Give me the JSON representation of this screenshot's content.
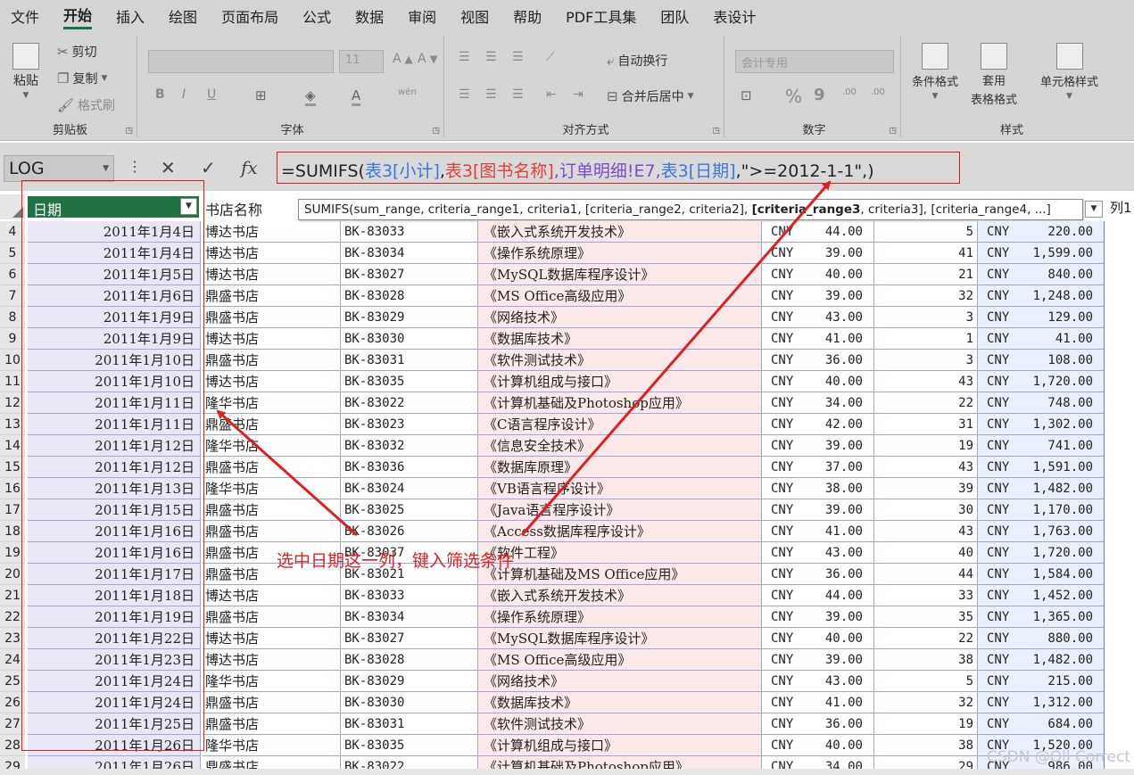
{
  "menu": [
    "文件",
    "开始",
    "插入",
    "绘图",
    "页面布局",
    "公式",
    "数据",
    "审阅",
    "视图",
    "帮助",
    "PDF工具集",
    "团队",
    "表设计"
  ],
  "ribbon": {
    "clipboard": {
      "paste": "粘贴",
      "cut": "剪切",
      "copy": "复制",
      "format_painter": "格式刷",
      "group": "剪贴板"
    },
    "font": {
      "font_size": "11",
      "bold": "B",
      "italic": "I",
      "underline": "U",
      "phonetic": "wén",
      "group": "字体"
    },
    "alignment": {
      "wrap": "自动换行",
      "merge": "合并后居中",
      "group": "对齐方式"
    },
    "number": {
      "format": "会计专用",
      "percent": "%",
      "comma": "9",
      "inc_decimal": ".00",
      "dec_decimal": ".00",
      "group": "数字"
    },
    "styles": {
      "conditional": "条件格式",
      "table_style_1": "套用",
      "table_style_2": "表格格式",
      "cell_style": "单元格样式",
      "group": "样式"
    }
  },
  "formula_bar": {
    "name_box": "LOG",
    "cancel": "✕",
    "enter": "✓",
    "fx": "fx",
    "formula": {
      "p1": "=SUMIFS(",
      "p2": "表3[小计]",
      "p3": ",",
      "p4": "表3[图书名称]",
      "p5": ",订单明细!E7,",
      "p6": "表3[日期]",
      "p7": ",\">=2012-1-1\",)"
    }
  },
  "tooltip": {
    "before": "SUMIFS(sum_range, criteria_range1, criteria1, [criteria_range2, criteria2], ",
    "bold": "[criteria_range3",
    "after": ", criteria3], [criteria_range4, ...]"
  },
  "headers": {
    "date": "日期",
    "store": "书店名称",
    "col1": "列1"
  },
  "rows": [
    {
      "n": "4",
      "date": "2011年1月4日",
      "store": "博达书店",
      "code": "BK-83033",
      "book": "《嵌入式系统开发技术》",
      "cur": "CNY",
      "price": "44.00",
      "qty": "5",
      "sub_cur": "CNY",
      "sub": "220.00"
    },
    {
      "n": "5",
      "date": "2011年1月4日",
      "store": "博达书店",
      "code": "BK-83034",
      "book": "《操作系统原理》",
      "cur": "CNY",
      "price": "39.00",
      "qty": "41",
      "sub_cur": "CNY",
      "sub": "1,599.00"
    },
    {
      "n": "6",
      "date": "2011年1月5日",
      "store": "博达书店",
      "code": "BK-83027",
      "book": "《MySQL数据库程序设计》",
      "cur": "CNY",
      "price": "40.00",
      "qty": "21",
      "sub_cur": "CNY",
      "sub": "840.00"
    },
    {
      "n": "7",
      "date": "2011年1月6日",
      "store": "鼎盛书店",
      "code": "BK-83028",
      "book": "《MS Office高级应用》",
      "cur": "CNY",
      "price": "39.00",
      "qty": "32",
      "sub_cur": "CNY",
      "sub": "1,248.00"
    },
    {
      "n": "8",
      "date": "2011年1月9日",
      "store": "鼎盛书店",
      "code": "BK-83029",
      "book": "《网络技术》",
      "cur": "CNY",
      "price": "43.00",
      "qty": "3",
      "sub_cur": "CNY",
      "sub": "129.00"
    },
    {
      "n": "9",
      "date": "2011年1月9日",
      "store": "博达书店",
      "code": "BK-83030",
      "book": "《数据库技术》",
      "cur": "CNY",
      "price": "41.00",
      "qty": "1",
      "sub_cur": "CNY",
      "sub": "41.00"
    },
    {
      "n": "10",
      "date": "2011年1月10日",
      "store": "鼎盛书店",
      "code": "BK-83031",
      "book": "《软件测试技术》",
      "cur": "CNY",
      "price": "36.00",
      "qty": "3",
      "sub_cur": "CNY",
      "sub": "108.00"
    },
    {
      "n": "11",
      "date": "2011年1月10日",
      "store": "博达书店",
      "code": "BK-83035",
      "book": "《计算机组成与接口》",
      "cur": "CNY",
      "price": "40.00",
      "qty": "43",
      "sub_cur": "CNY",
      "sub": "1,720.00"
    },
    {
      "n": "12",
      "date": "2011年1月11日",
      "store": "隆华书店",
      "code": "BK-83022",
      "book": "《计算机基础及Photoshop应用》",
      "cur": "CNY",
      "price": "34.00",
      "qty": "22",
      "sub_cur": "CNY",
      "sub": "748.00"
    },
    {
      "n": "13",
      "date": "2011年1月11日",
      "store": "鼎盛书店",
      "code": "BK-83023",
      "book": "《C语言程序设计》",
      "cur": "CNY",
      "price": "42.00",
      "qty": "31",
      "sub_cur": "CNY",
      "sub": "1,302.00"
    },
    {
      "n": "14",
      "date": "2011年1月12日",
      "store": "隆华书店",
      "code": "BK-83032",
      "book": "《信息安全技术》",
      "cur": "CNY",
      "price": "39.00",
      "qty": "19",
      "sub_cur": "CNY",
      "sub": "741.00"
    },
    {
      "n": "15",
      "date": "2011年1月12日",
      "store": "鼎盛书店",
      "code": "BK-83036",
      "book": "《数据库原理》",
      "cur": "CNY",
      "price": "37.00",
      "qty": "43",
      "sub_cur": "CNY",
      "sub": "1,591.00"
    },
    {
      "n": "16",
      "date": "2011年1月13日",
      "store": "隆华书店",
      "code": "BK-83024",
      "book": "《VB语言程序设计》",
      "cur": "CNY",
      "price": "38.00",
      "qty": "39",
      "sub_cur": "CNY",
      "sub": "1,482.00"
    },
    {
      "n": "17",
      "date": "2011年1月15日",
      "store": "鼎盛书店",
      "code": "BK-83025",
      "book": "《Java语言程序设计》",
      "cur": "CNY",
      "price": "39.00",
      "qty": "30",
      "sub_cur": "CNY",
      "sub": "1,170.00"
    },
    {
      "n": "18",
      "date": "2011年1月16日",
      "store": "鼎盛书店",
      "code": "BK-83026",
      "book": "《Access数据库程序设计》",
      "cur": "CNY",
      "price": "41.00",
      "qty": "43",
      "sub_cur": "CNY",
      "sub": "1,763.00"
    },
    {
      "n": "19",
      "date": "2011年1月16日",
      "store": "鼎盛书店",
      "code": "BK-83037",
      "book": "《软件工程》",
      "cur": "CNY",
      "price": "43.00",
      "qty": "40",
      "sub_cur": "CNY",
      "sub": "1,720.00"
    },
    {
      "n": "20",
      "date": "2011年1月17日",
      "store": "鼎盛书店",
      "code": "BK-83021",
      "book": "《计算机基础及MS Office应用》",
      "cur": "CNY",
      "price": "36.00",
      "qty": "44",
      "sub_cur": "CNY",
      "sub": "1,584.00"
    },
    {
      "n": "21",
      "date": "2011年1月18日",
      "store": "博达书店",
      "code": "BK-83033",
      "book": "《嵌入式系统开发技术》",
      "cur": "CNY",
      "price": "44.00",
      "qty": "33",
      "sub_cur": "CNY",
      "sub": "1,452.00"
    },
    {
      "n": "22",
      "date": "2011年1月19日",
      "store": "鼎盛书店",
      "code": "BK-83034",
      "book": "《操作系统原理》",
      "cur": "CNY",
      "price": "39.00",
      "qty": "35",
      "sub_cur": "CNY",
      "sub": "1,365.00"
    },
    {
      "n": "23",
      "date": "2011年1月22日",
      "store": "博达书店",
      "code": "BK-83027",
      "book": "《MySQL数据库程序设计》",
      "cur": "CNY",
      "price": "40.00",
      "qty": "22",
      "sub_cur": "CNY",
      "sub": "880.00"
    },
    {
      "n": "24",
      "date": "2011年1月23日",
      "store": "博达书店",
      "code": "BK-83028",
      "book": "《MS Office高级应用》",
      "cur": "CNY",
      "price": "39.00",
      "qty": "38",
      "sub_cur": "CNY",
      "sub": "1,482.00"
    },
    {
      "n": "25",
      "date": "2011年1月24日",
      "store": "隆华书店",
      "code": "BK-83029",
      "book": "《网络技术》",
      "cur": "CNY",
      "price": "43.00",
      "qty": "5",
      "sub_cur": "CNY",
      "sub": "215.00"
    },
    {
      "n": "26",
      "date": "2011年1月24日",
      "store": "鼎盛书店",
      "code": "BK-83030",
      "book": "《数据库技术》",
      "cur": "CNY",
      "price": "41.00",
      "qty": "32",
      "sub_cur": "CNY",
      "sub": "1,312.00"
    },
    {
      "n": "27",
      "date": "2011年1月25日",
      "store": "鼎盛书店",
      "code": "BK-83031",
      "book": "《软件测试技术》",
      "cur": "CNY",
      "price": "36.00",
      "qty": "19",
      "sub_cur": "CNY",
      "sub": "684.00"
    },
    {
      "n": "28",
      "date": "2011年1月26日",
      "store": "隆华书店",
      "code": "BK-83035",
      "book": "《计算机组成与接口》",
      "cur": "CNY",
      "price": "40.00",
      "qty": "38",
      "sub_cur": "CNY",
      "sub": "1,520.00"
    },
    {
      "n": "29",
      "date": "2011年1月26日",
      "store": "鼎盛书店",
      "code": "BK-83022",
      "book": "《计算机基础及Photoshop应用》",
      "cur": "CNY",
      "price": "34.00",
      "qty": "29",
      "sub_cur": "CNY",
      "sub": "986.00"
    }
  ],
  "annotation": "选中日期这一列，键入筛选条件",
  "watermark": "CSDN @Oll Correct",
  "colors": {
    "accent": "#217346",
    "annotation_red": "#e02020",
    "header_green": "#217346"
  }
}
